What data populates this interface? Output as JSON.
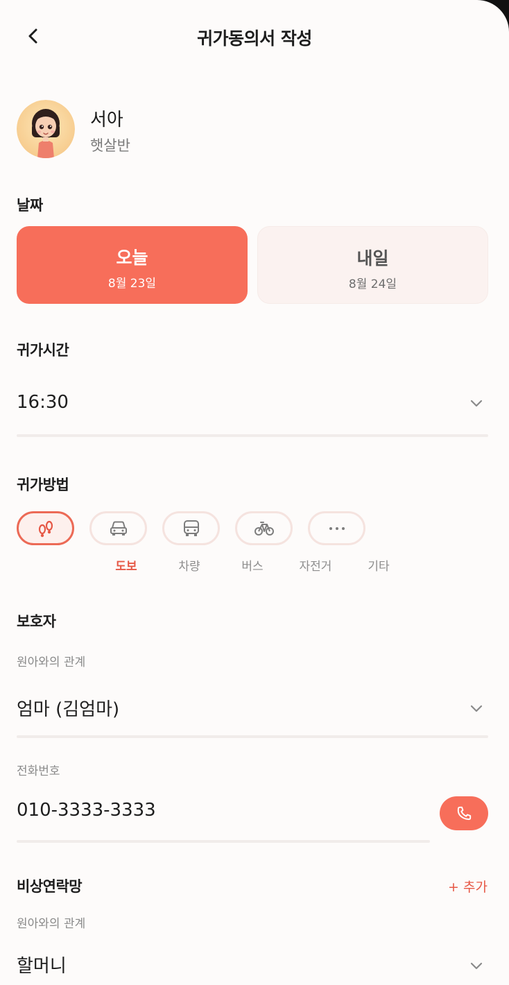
{
  "header": {
    "title": "귀가동의서 작성"
  },
  "child": {
    "name": "서아",
    "class_name": "햇살반"
  },
  "date": {
    "label": "날짜",
    "options": [
      {
        "label": "오늘",
        "date": "8월 23일",
        "selected": true
      },
      {
        "label": "내일",
        "date": "8월 24일",
        "selected": false
      }
    ]
  },
  "time": {
    "label": "귀가시간",
    "value": "16:30"
  },
  "method": {
    "label": "귀가방법",
    "selected": "도보",
    "options": [
      {
        "label": "도보",
        "icon": "footprints-icon"
      },
      {
        "label": "차량",
        "icon": "car-icon"
      },
      {
        "label": "버스",
        "icon": "bus-icon"
      },
      {
        "label": "자전거",
        "icon": "bicycle-icon"
      },
      {
        "label": "기타",
        "icon": "more-icon"
      }
    ]
  },
  "guardian": {
    "label": "보호자",
    "relation_label": "원아와의 관계",
    "relation_value": "엄마 (김엄마)",
    "phone_label": "전화번호",
    "phone_value": "010-3333-3333"
  },
  "emergency": {
    "label": "비상연락망",
    "add_label": "+ 추가",
    "relation_label": "원아와의 관계",
    "relation_value": "할머니"
  },
  "colors": {
    "accent": "#f76e5a",
    "accent_text": "#e65846"
  }
}
